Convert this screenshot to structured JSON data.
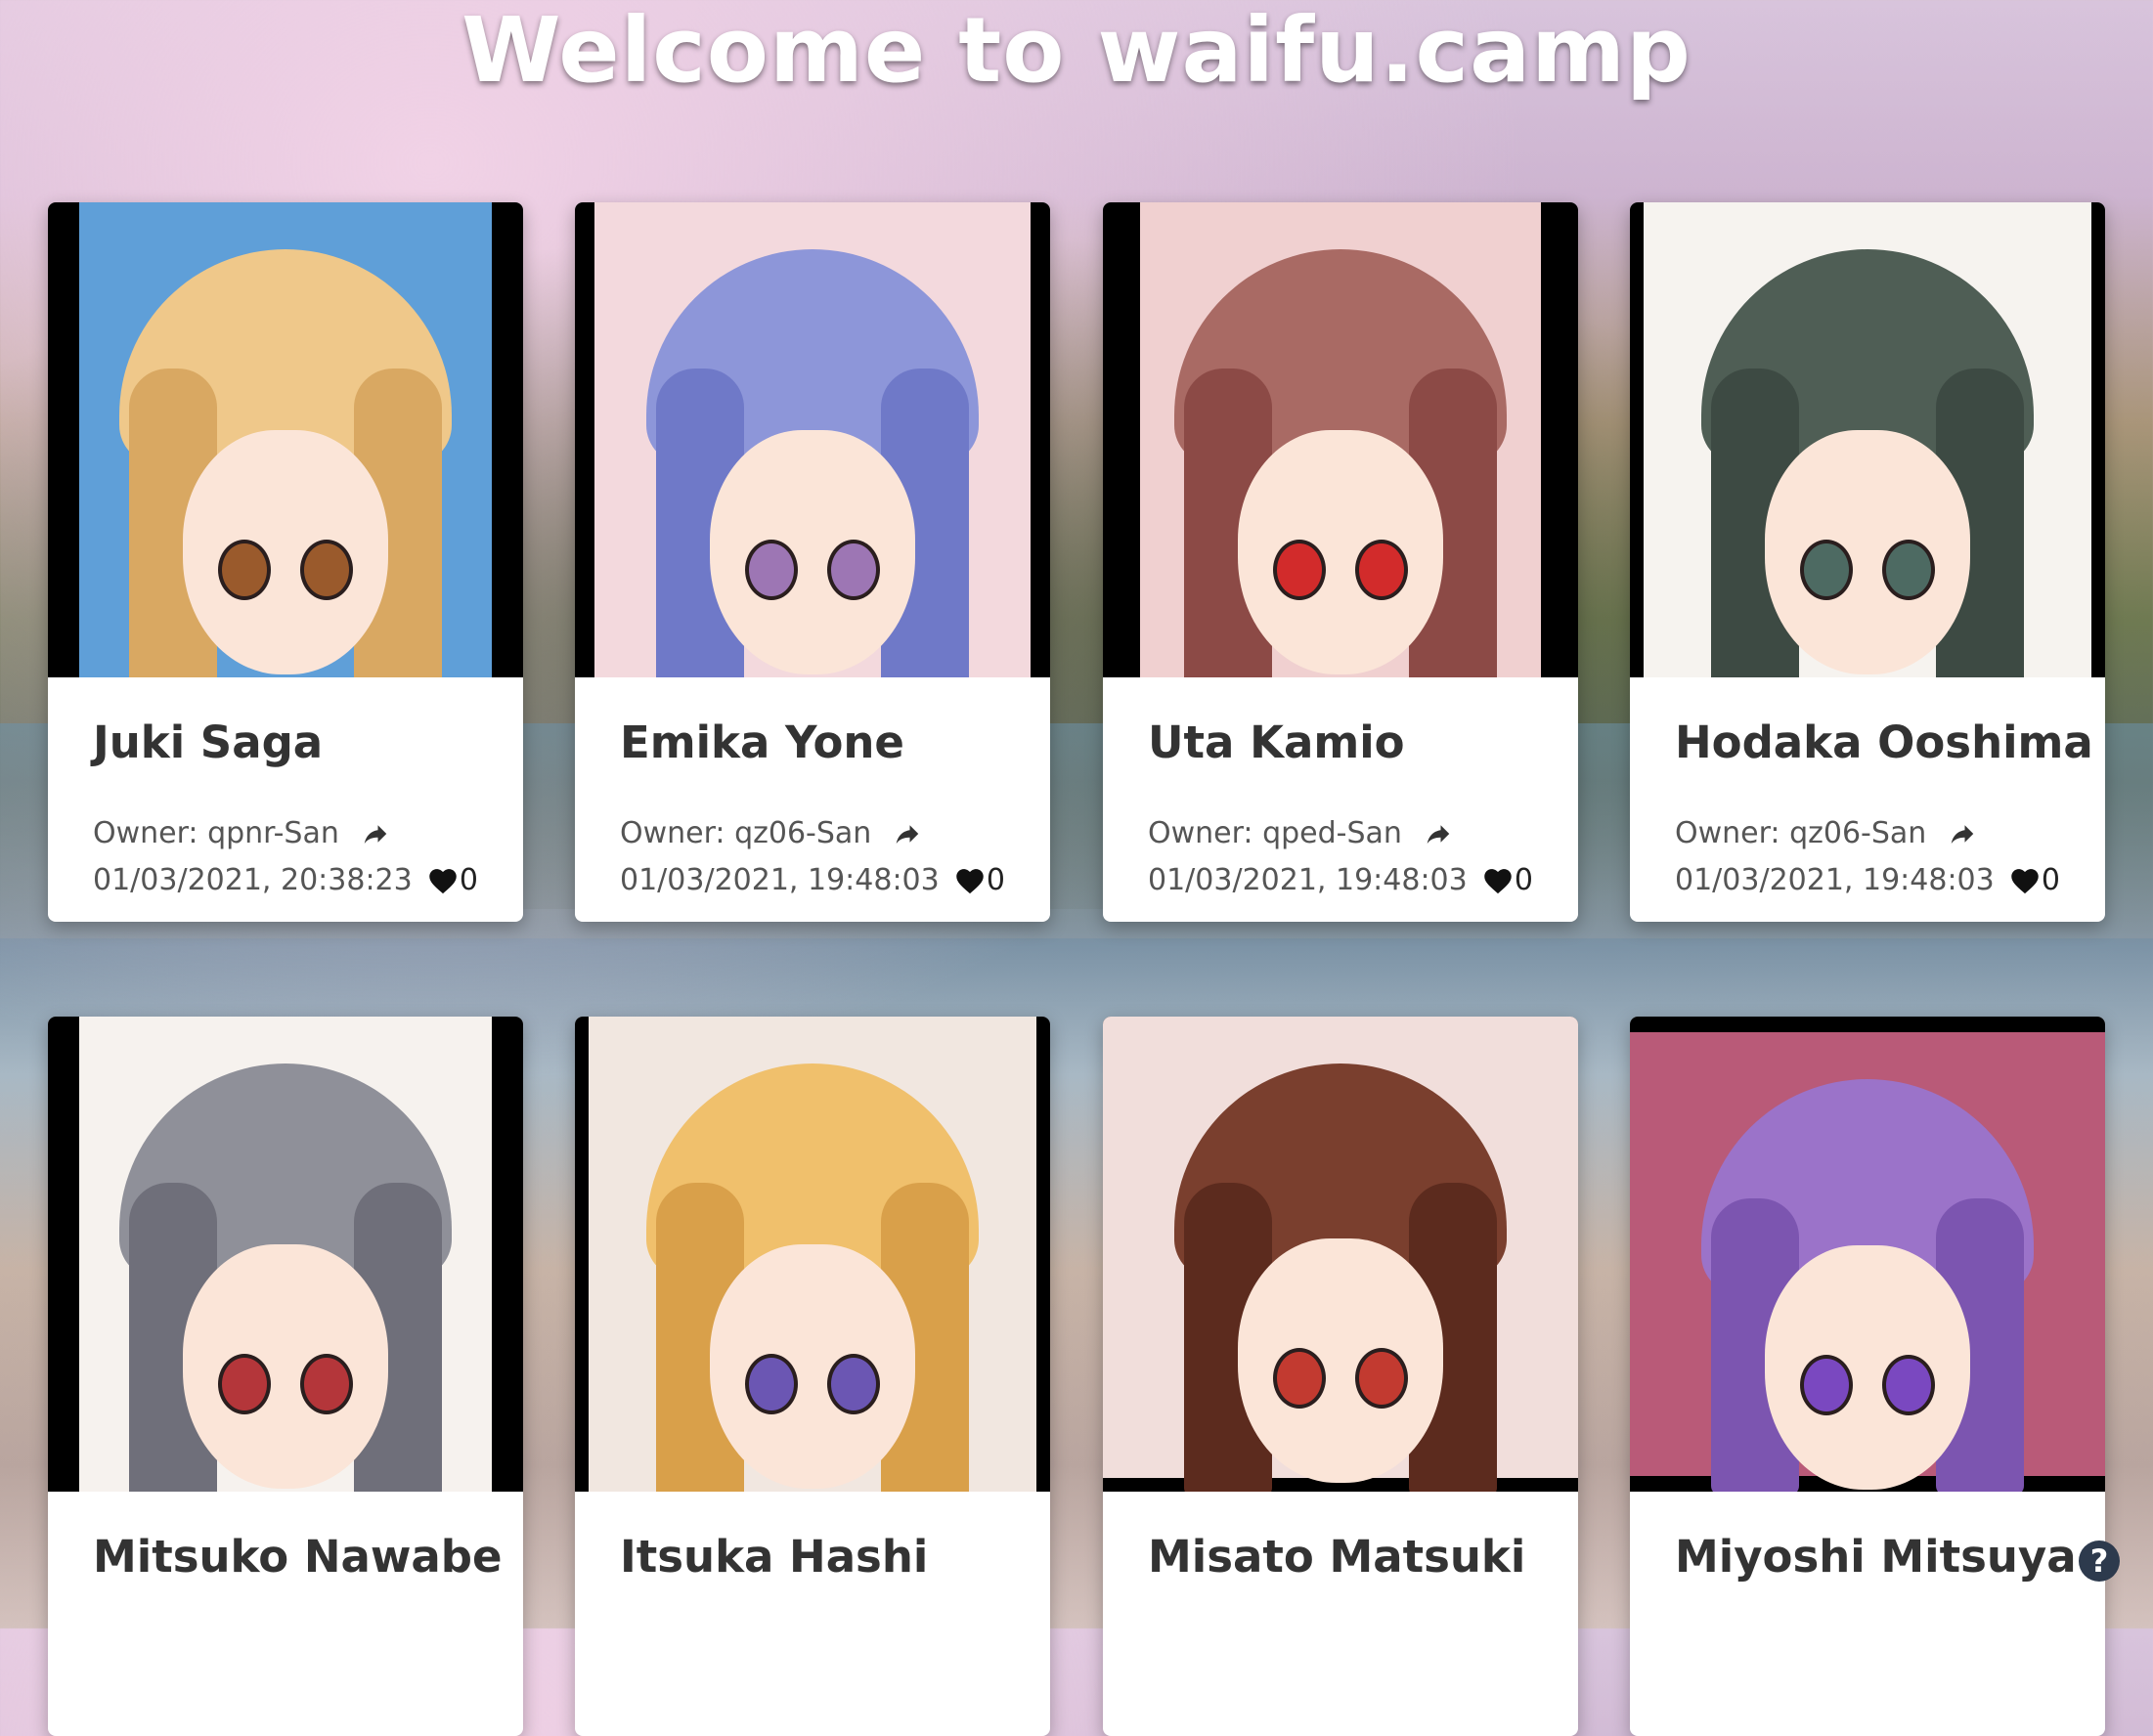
{
  "page": {
    "title": "Welcome to waifu.camp"
  },
  "cards": [
    {
      "name": "Juki Saga",
      "owner": "Owner: qpnr-San",
      "date": "01/03/2021, 20:38:23",
      "likes": "0",
      "colors": {
        "bg": "#5f9fd8",
        "hair": "#efc88a",
        "hair_dark": "#d9a862",
        "eye": "#9a5a2c"
      }
    },
    {
      "name": "Emika Yone",
      "owner": "Owner: qz06-San",
      "date": "01/03/2021, 19:48:03",
      "likes": "0",
      "colors": {
        "bg": "#f3d9dd",
        "hair": "#8d96d9",
        "hair_dark": "#6f79c8",
        "eye": "#9d76b4"
      }
    },
    {
      "name": "Uta Kamio",
      "owner": "Owner: qped-San",
      "date": "01/03/2021, 19:48:03",
      "likes": "0",
      "colors": {
        "bg": "#f0d0d0",
        "hair": "#a96a64",
        "hair_dark": "#8c4a46",
        "eye": "#d22b2b"
      }
    },
    {
      "name": "Hodaka Ooshima",
      "owner": "Owner: qz06-San",
      "date": "01/03/2021, 19:48:03",
      "likes": "0",
      "colors": {
        "bg": "#f6f3ef",
        "hair": "#4f5e55",
        "hair_dark": "#3d4a43",
        "eye": "#4d6a62"
      }
    },
    {
      "name": "Mitsuko Nawabe",
      "owner": "",
      "date": "",
      "likes": "",
      "colors": {
        "bg": "#f6f2ee",
        "hair": "#8f9099",
        "hair_dark": "#6f6f7a",
        "eye": "#b4363a"
      }
    },
    {
      "name": "Itsuka Hashi",
      "owner": "",
      "date": "",
      "likes": "",
      "colors": {
        "bg": "#f1e7e0",
        "hair": "#f0c06c",
        "hair_dark": "#d9a04a",
        "eye": "#6b56b3"
      }
    },
    {
      "name": "Misato Matsuki",
      "owner": "",
      "date": "",
      "likes": "",
      "colors": {
        "bg": "#f1dedb",
        "hair": "#7a3f2e",
        "hair_dark": "#5c2b1e",
        "eye": "#c23a30"
      }
    },
    {
      "name": "Miyoshi Mitsuya",
      "owner": "",
      "date": "",
      "likes": "",
      "colors": {
        "bg": "#b95a78",
        "hair": "#9b73c9",
        "hair_dark": "#7c55b0",
        "eye": "#7a48c0"
      }
    }
  ],
  "help": {
    "glyph": "?"
  },
  "icons": {
    "share": "share-arrow-icon",
    "like": "heart-icon",
    "help": "question-circle-icon"
  }
}
